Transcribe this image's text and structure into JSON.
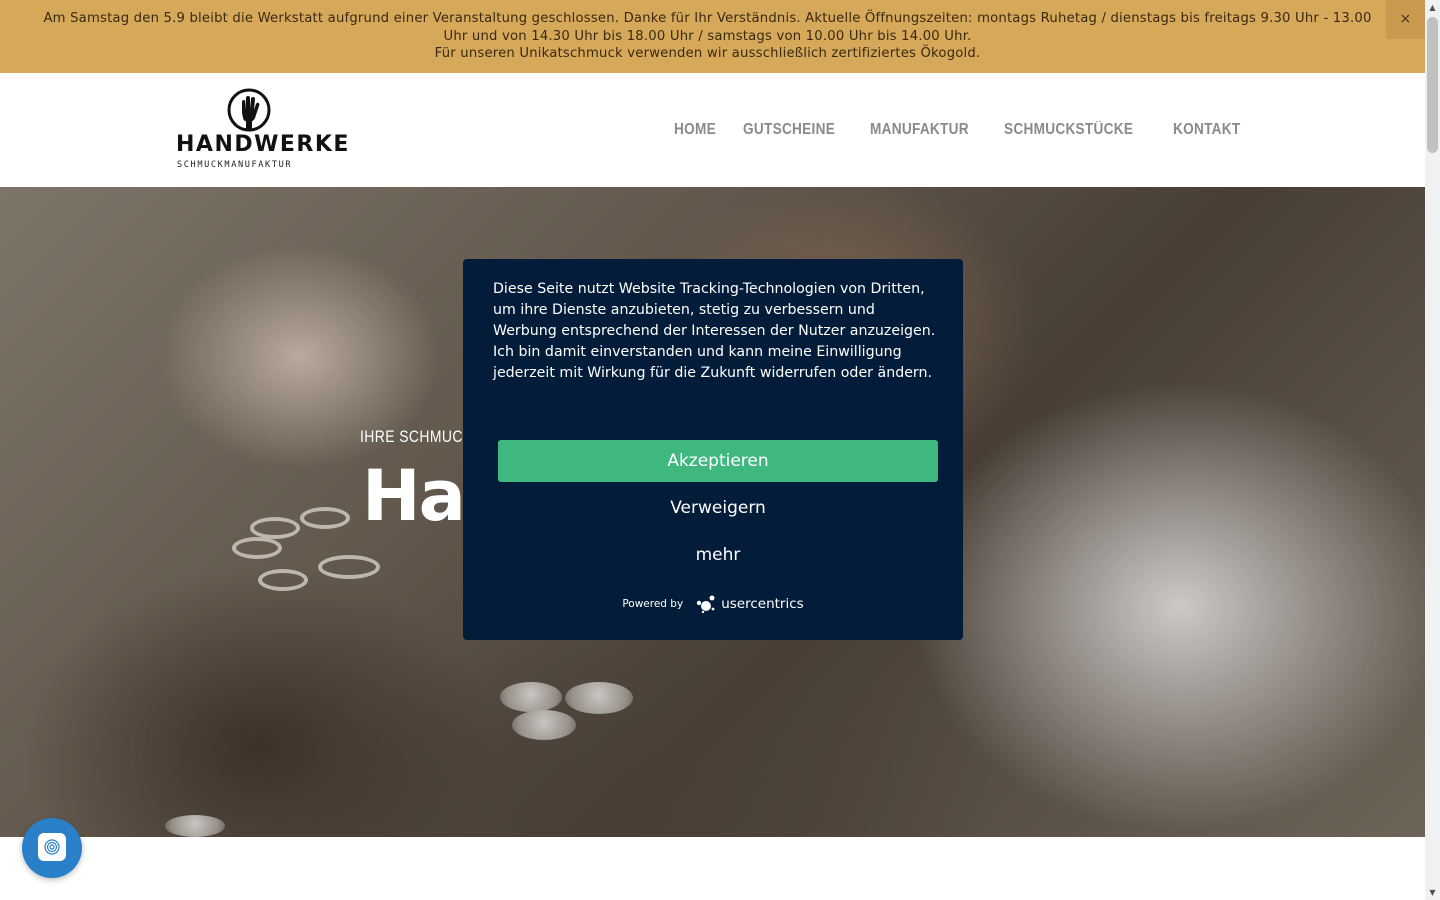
{
  "notice": {
    "line1": "Am Samstag den 5.9 bleibt die Werkstatt aufgrund einer Veranstaltung geschlossen. Danke für Ihr Verständnis. Aktuelle Öffnungszeiten: montags Ruhetag / dienstags bis freitags 9.30 Uhr - 13.00 Uhr und von 14.30 Uhr bis 18.00 Uhr / samstags von 10.00 Uhr bis 14.00 Uhr.",
    "line2": "Für unseren Unikatschmuck verwenden wir ausschließlich zertifiziertes Ökogold.",
    "close_label": "×",
    "background": "#d6a85a"
  },
  "header": {
    "logo_word": "HANDWERKE",
    "logo_sub": "SCHMUCKMANUFAKTUR",
    "logo_icon": "hand-icon",
    "nav": [
      {
        "label": "HOME"
      },
      {
        "label": "GUTSCHEINE"
      },
      {
        "label": "MANUFAKTUR"
      },
      {
        "label": "SCHMUCKSTÜCKE"
      },
      {
        "label": "KONTAKT"
      }
    ]
  },
  "hero": {
    "subtitle": "IHRE SCHMUCKM",
    "title": "Ha"
  },
  "consent": {
    "text": "Diese Seite nutzt Website Tracking-Technologien von Dritten, um ihre Dienste anzubieten, stetig zu verbessern und Werbung entsprechend der Interessen der Nutzer anzuzeigen. Ich bin damit einverstanden und kann meine Einwilligung jederzeit mit Wirkung für die Zukunft widerrufen oder ändern.",
    "accept_label": "Akzeptieren",
    "deny_label": "Verweigern",
    "more_label": "mehr",
    "powered_by": "Powered by",
    "brand": "usercentrics",
    "background": "#021c3a",
    "accept_color": "#3fb87f"
  },
  "fab": {
    "icon": "fingerprint-icon",
    "color": "#2a7fc9"
  }
}
